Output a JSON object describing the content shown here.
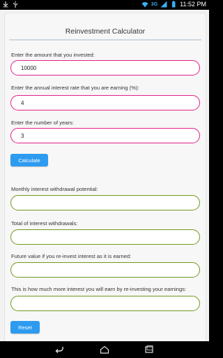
{
  "status_bar": {
    "network_label": "3G",
    "time": "11:52 PM",
    "icons": [
      "download-icon",
      "usb-icon",
      "wifi-icon",
      "signal-icon",
      "battery-icon"
    ]
  },
  "app": {
    "title": "Reinvestment Calculator",
    "inputs": [
      {
        "label": "Enter the amount that you invested:",
        "value": "10000"
      },
      {
        "label": "Enter the annual interest rate that you are earning (%):",
        "value": "4"
      },
      {
        "label": "Enter the number of years:",
        "value": "3"
      }
    ],
    "calculate_label": "Calculate",
    "outputs": [
      {
        "label": "Monthly interest withdrawal potential:",
        "value": ""
      },
      {
        "label": "Total of interest withdrawals:",
        "value": ""
      },
      {
        "label": "Future value if you re-invest interest as it is earned:",
        "value": ""
      },
      {
        "label": "This is how much more interest you will earn by re-investing your earnings:",
        "value": ""
      }
    ],
    "reset_label": "Reset"
  },
  "colors": {
    "input_border": "#e0218a",
    "output_border": "#6f9a1a",
    "button": "#2d9bf0"
  },
  "nav_bar": {
    "icons": [
      "back-icon",
      "home-icon",
      "recents-icon"
    ]
  }
}
